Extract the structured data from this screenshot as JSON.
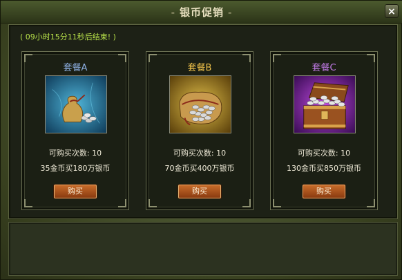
{
  "window": {
    "title": "银币促销",
    "title_dash": "-",
    "close_label": "×"
  },
  "timer_text": "( 09小时15分11秒后结束! )",
  "packages": [
    {
      "title": "套餐A",
      "title_color": "#8fb2e6",
      "limit_text": "可购买次数: 10",
      "price_text": "35金币买180万银币",
      "buy_label": "购买",
      "image": "small-money-bag-icon"
    },
    {
      "title": "套餐B",
      "title_color": "#f0c24a",
      "limit_text": "可购买次数: 10",
      "price_text": "70金币买400万银币",
      "buy_label": "购买",
      "image": "silver-coin-sack-icon"
    },
    {
      "title": "套餐C",
      "title_color": "#c17ae6",
      "limit_text": "可购买次数: 10",
      "price_text": "130金币买850万银币",
      "buy_label": "购买",
      "image": "treasure-chest-icon"
    }
  ]
}
